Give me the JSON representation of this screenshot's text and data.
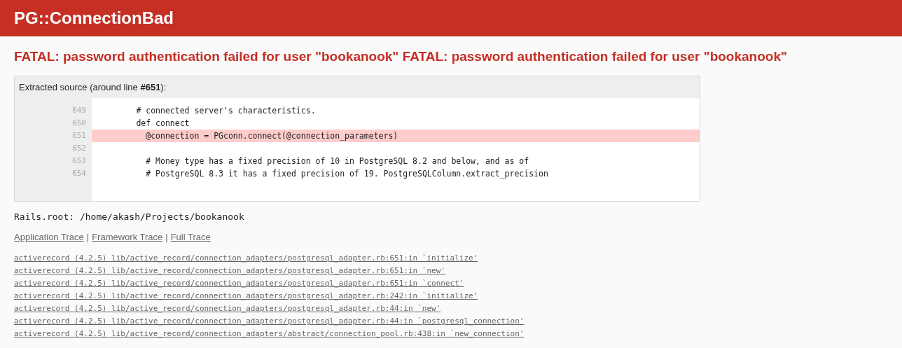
{
  "header": {
    "title": "PG::ConnectionBad"
  },
  "error_message": "FATAL: password authentication failed for user \"bookanook\" FATAL: password authentication failed for user \"bookanook\"",
  "source": {
    "caption": "Extracted source (around line **#651**):",
    "lines": [
      {
        "number": "649",
        "code": "        # connected server's characteristics.",
        "highlighted": false
      },
      {
        "number": "650",
        "code": "        def connect",
        "highlighted": false
      },
      {
        "number": "651",
        "code": "          @connection = PGconn.connect(@connection_parameters)",
        "highlighted": true
      },
      {
        "number": "652",
        "highlighted": false
      },
      {
        "number": "653",
        "code": "          # Money type has a fixed precision of 10 in PostgreSQL 8.2 and below, and as of",
        "highlighted": false
      },
      {
        "number": "654",
        "code": "          # PostgreSQL 8.3 it has a fixed precision of 19. PostgreSQLColumn.extract_precision",
        "highlighted": false
      }
    ]
  },
  "rails_root": "Rails.root: /home/akash/Projects/bookanook",
  "trace_links": [
    "Application Trace",
    "Framework Trace",
    "Full Trace"
  ],
  "trace_separator": "|",
  "trace": [
    "activerecord (4.2.5) lib/active_record/connection_adapters/postgresql_adapter.rb:651:in `initialize'",
    "activerecord (4.2.5) lib/active_record/connection_adapters/postgresql_adapter.rb:651:in `new'",
    "activerecord (4.2.5) lib/active_record/connection_adapters/postgresql_adapter.rb:651:in `connect'",
    "activerecord (4.2.5) lib/active_record/connection_adapters/postgresql_adapter.rb:242:in `initialize'",
    "activerecord (4.2.5) lib/active_record/connection_adapters/postgresql_adapter.rb:44:in `new'",
    "activerecord (4.2.5) lib/active_record/connection_adapters/postgresql_adapter.rb:44:in `postgresql_connection'",
    "activerecord (4.2.5) lib/active_record/connection_adapters/abstract/connection_pool.rb:438:in `new_connection'"
  ]
}
